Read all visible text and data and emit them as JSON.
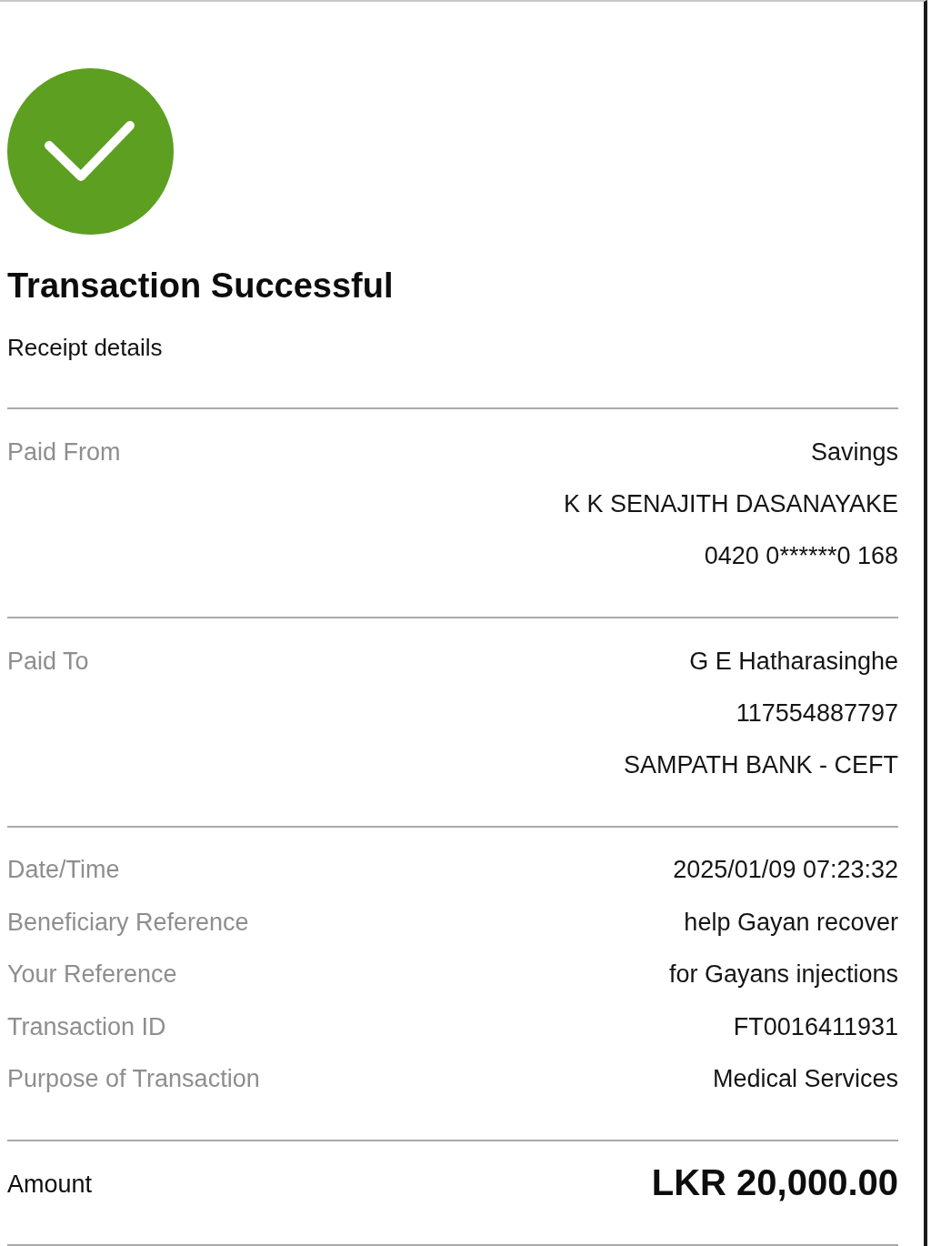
{
  "status": {
    "kind": "success",
    "title": "Transaction Successful",
    "subtitle": "Receipt details"
  },
  "sections": [
    {
      "label": "Paid From",
      "values": [
        "Savings",
        "K K SENAJITH DASANAYAKE",
        "0420 0******0 168"
      ]
    },
    {
      "label": "Paid To",
      "values": [
        "G E Hatharasinghe",
        "117554887797",
        "SAMPATH BANK - CEFT"
      ]
    }
  ],
  "details": [
    {
      "label": "Date/Time",
      "value": "2025/01/09 07:23:32"
    },
    {
      "label": "Beneficiary Reference",
      "value": "help Gayan recover"
    },
    {
      "label": "Your Reference",
      "value": "for Gayans injections"
    },
    {
      "label": "Transaction ID",
      "value": "FT0016411931"
    },
    {
      "label": "Purpose of Transaction",
      "value": "Medical Services"
    }
  ],
  "total": {
    "label": "Amount",
    "value": "LKR 20,000.00"
  }
}
